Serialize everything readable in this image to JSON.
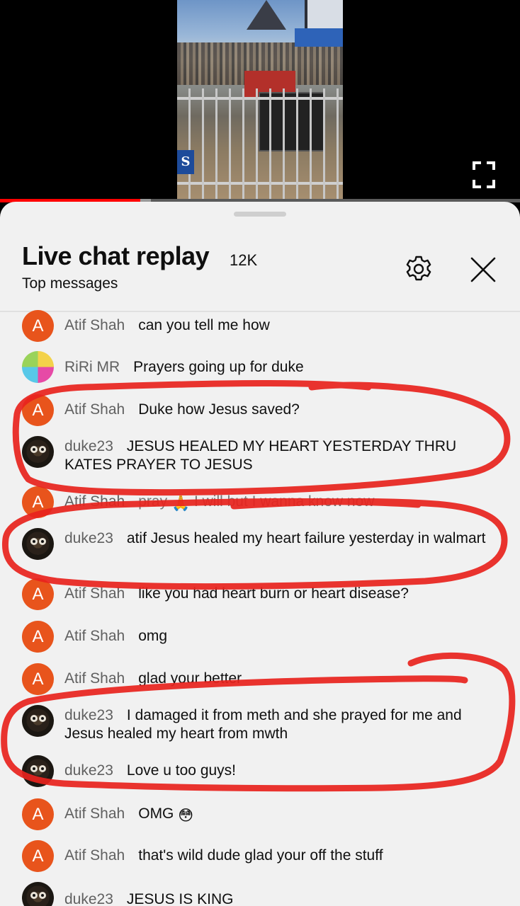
{
  "video": {
    "progress_fraction": 0.27,
    "buffer_fraction": 0.29,
    "sign_text": "S"
  },
  "panel": {
    "title": "Live chat replay",
    "viewer_count": "12K",
    "subtitle": "Top messages"
  },
  "icons": {
    "fullscreen": "fullscreen-icon",
    "settings": "gear-icon",
    "close": "close-icon"
  },
  "colors": {
    "accent_red": "#ff0000",
    "avatar_orange": "#e8541c",
    "annotation_red": "#e8231d"
  },
  "messages": [
    {
      "author": "Atif Shah",
      "text": "can you tell me how",
      "avatar": "A"
    },
    {
      "author": "RiRi MR",
      "text": "Prayers going up for duke",
      "avatar": ""
    },
    {
      "author": "Atif Shah",
      "text": "Duke how Jesus saved?",
      "avatar": "A"
    },
    {
      "author": "duke23",
      "text": "JESUS HEALED MY HEART YESTERDAY THRU KATES PRAYER TO JESUS",
      "avatar": ""
    },
    {
      "author": "Atif Shah",
      "text": "pray",
      "text_after": "I will but I wanna know now",
      "emoji": "🙏",
      "avatar": "A"
    },
    {
      "author": "duke23",
      "text": "atif Jesus healed my heart failure yesterday in walmart",
      "avatar": ""
    },
    {
      "author": "Atif Shah",
      "text": "like you had heart burn or heart disease?",
      "avatar": "A"
    },
    {
      "author": "Atif Shah",
      "text": "omg",
      "avatar": "A"
    },
    {
      "author": "Atif Shah",
      "text": "glad your better",
      "avatar": "A"
    },
    {
      "author": "duke23",
      "text": "I damaged it from meth and she prayed for me and Jesus healed my heart from mwth",
      "avatar": ""
    },
    {
      "author": "duke23",
      "text": "Love u too guys!",
      "avatar": ""
    },
    {
      "author": "Atif Shah",
      "text": "OMG",
      "emoji": "😳",
      "avatar": "A"
    },
    {
      "author": "Atif Shah",
      "text": "that's wild dude glad your off the stuff",
      "avatar": "A"
    },
    {
      "author": "duke23",
      "text": "JESUS IS KING",
      "avatar": ""
    }
  ]
}
